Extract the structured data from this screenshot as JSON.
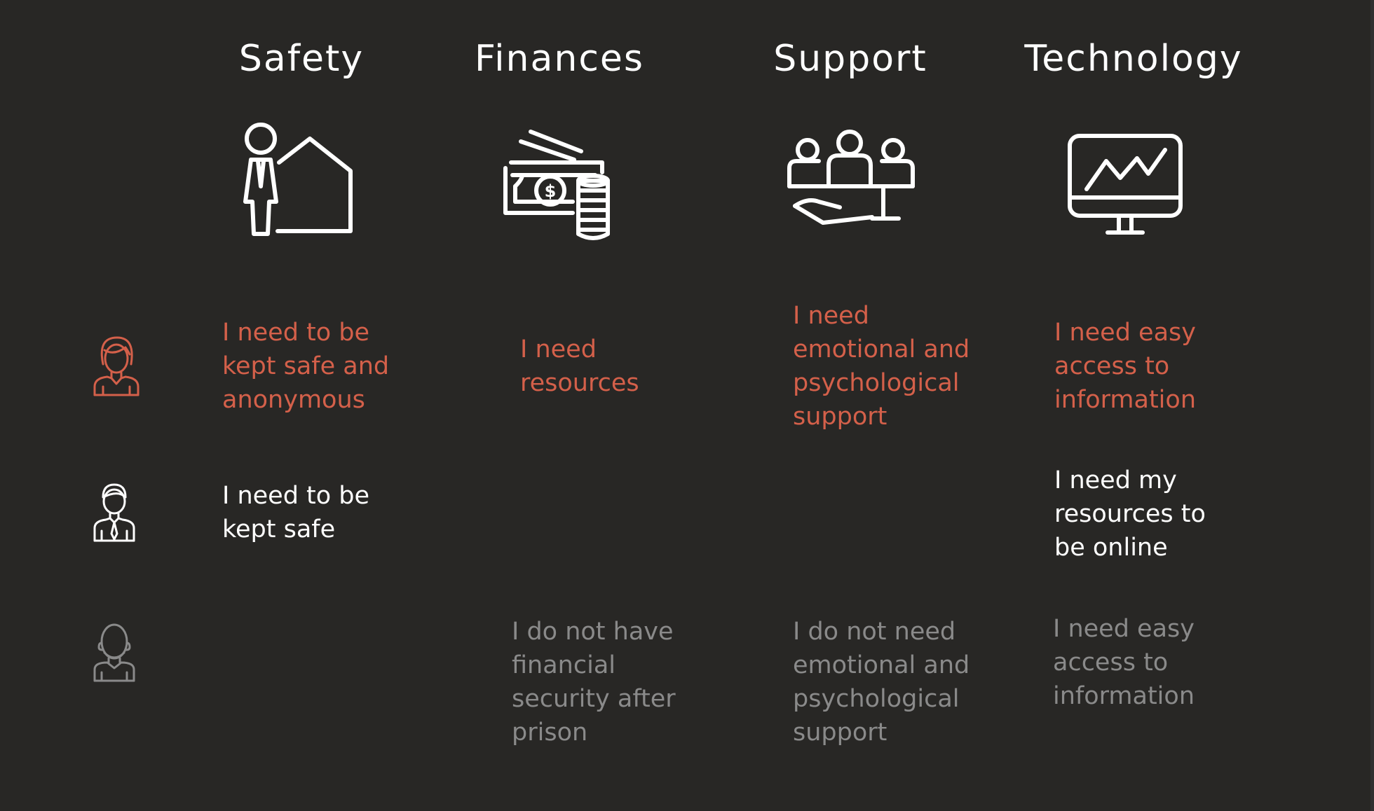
{
  "categories": [
    {
      "key": "safety",
      "label": "Safety",
      "icon": "person-house-icon"
    },
    {
      "key": "finances",
      "label": "Finances",
      "icon": "money-coins-icon"
    },
    {
      "key": "support",
      "label": "Support",
      "icon": "hand-people-icon"
    },
    {
      "key": "technology",
      "label": "Technology",
      "icon": "monitor-chart-icon"
    }
  ],
  "personas": [
    {
      "icon": "woman-avatar-icon",
      "color": "#d4604a"
    },
    {
      "icon": "businessman-avatar-icon",
      "color": "#ffffff"
    },
    {
      "icon": "bald-man-avatar-icon",
      "color": "#8a8a8a"
    }
  ],
  "colors": {
    "background": "#282725",
    "accent": "#d4604a",
    "primary_text": "#ffffff",
    "muted_text": "#8a8a8a"
  },
  "needs": {
    "persona1": {
      "safety": [
        "I need to be",
        "kept safe and",
        "anonymous"
      ],
      "finances": [
        "I need",
        "resources"
      ],
      "support": [
        "I need",
        "emotional and",
        "psychological",
        "support"
      ],
      "technology": [
        "I need easy",
        "access to",
        "information"
      ]
    },
    "persona2": {
      "safety": [
        "I need to be",
        "kept safe"
      ],
      "technology": [
        "I need my",
        "resources to",
        "be online"
      ]
    },
    "persona3": {
      "finances": [
        "I do not have",
        "financial",
        "security after",
        "prison"
      ],
      "support": [
        "I do not need",
        "emotional and",
        "psychological",
        "support"
      ],
      "technology": [
        "I need easy",
        "access to",
        "information"
      ]
    }
  }
}
